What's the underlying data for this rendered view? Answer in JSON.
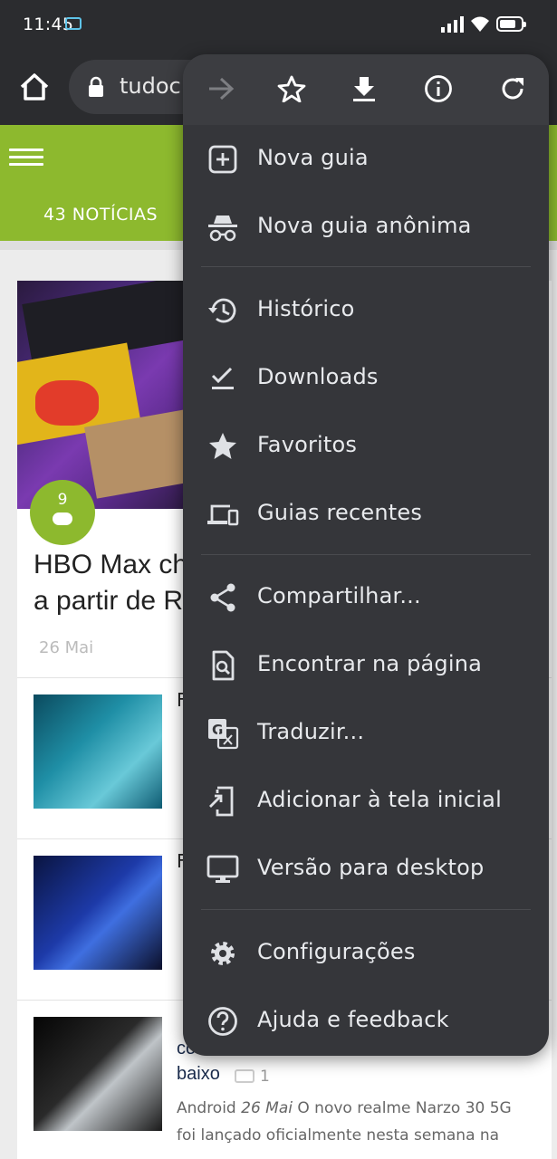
{
  "status_bar": {
    "time": "11:45"
  },
  "browser": {
    "url_text": "tudoc"
  },
  "page": {
    "news_count": "43 NOTÍCIAS",
    "featured": {
      "comment_count": "9",
      "title_line1": "HBO Max che",
      "title_line2": "a partir de R$",
      "date": "26 Mai"
    },
    "rows": [
      {
        "text": "F"
      },
      {
        "text": "F"
      },
      {
        "title_line1": "com",
        "title_line2": "baixo",
        "comments": "1",
        "category": "Android",
        "date": "26 Mai",
        "snippet": " O novo realme Narzo 30 5G foi lançado oficialmente nesta semana na"
      }
    ]
  },
  "menu": {
    "top_icons": [
      "forward-icon",
      "star-icon",
      "download-icon",
      "info-icon",
      "refresh-icon"
    ],
    "items": [
      {
        "label": "Nova guia",
        "icon": "new-tab-icon"
      },
      {
        "label": "Nova guia anônima",
        "icon": "incognito-icon"
      },
      {
        "label": "Histórico",
        "icon": "history-icon"
      },
      {
        "label": "Downloads",
        "icon": "downloads-check-icon"
      },
      {
        "label": "Favoritos",
        "icon": "star-filled-icon"
      },
      {
        "label": "Guias recentes",
        "icon": "devices-icon"
      },
      {
        "label": "Compartilhar...",
        "icon": "share-icon"
      },
      {
        "label": "Encontrar na página",
        "icon": "find-in-page-icon"
      },
      {
        "label": "Traduzir...",
        "icon": "translate-icon"
      },
      {
        "label": "Adicionar à tela inicial",
        "icon": "add-to-home-icon"
      },
      {
        "label": "Versão para desktop",
        "icon": "desktop-icon"
      },
      {
        "label": "Configurações",
        "icon": "gear-icon"
      },
      {
        "label": "Ajuda e feedback",
        "icon": "help-icon"
      }
    ]
  }
}
